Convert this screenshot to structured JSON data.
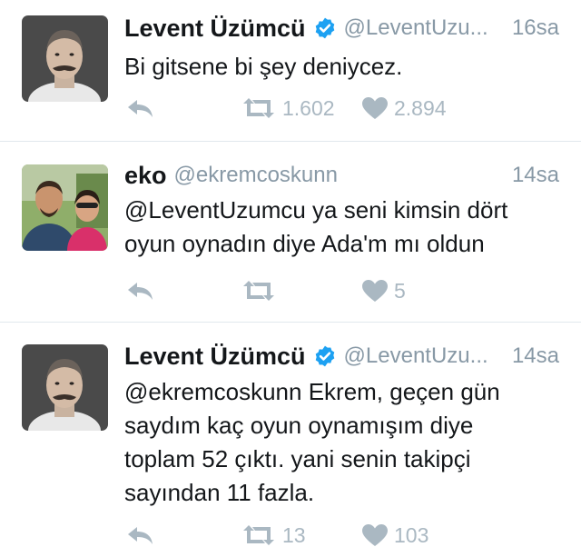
{
  "colors": {
    "text": "#14171a",
    "secondary": "#8899a6",
    "action_icon": "#aab8c2",
    "verified_badge": "#1da1f2",
    "divider": "#e1e8ed"
  },
  "tweets": [
    {
      "name": "Levent Üzümcü",
      "verified": true,
      "handle": "@LeventUzu...",
      "time": "16sa",
      "text_lines": [
        "Bi gitsene bi şey deniycez."
      ],
      "reply_icon": "reply-icon",
      "retweet_count": "1.602",
      "like_count": "2.894"
    },
    {
      "name": "eko",
      "verified": false,
      "handle": "@ekremcoskunn",
      "time": "14sa",
      "text_lines": [
        "@LeventUzumcu ya seni kimsin dört",
        "oyun oynadın diye Ada'm mı oldun"
      ],
      "retweet_count": "",
      "like_count": "5"
    },
    {
      "name": "Levent Üzümcü",
      "verified": true,
      "handle": "@LeventUzu...",
      "time": "14sa",
      "text_lines": [
        "@ekremcoskunn Ekrem, geçen gün",
        "saydım kaç oyun oynamışım diye",
        "toplam 52 çıktı. yani senin takipçi",
        "sayından 11 fazla."
      ],
      "retweet_count": "13",
      "like_count": "103"
    }
  ]
}
